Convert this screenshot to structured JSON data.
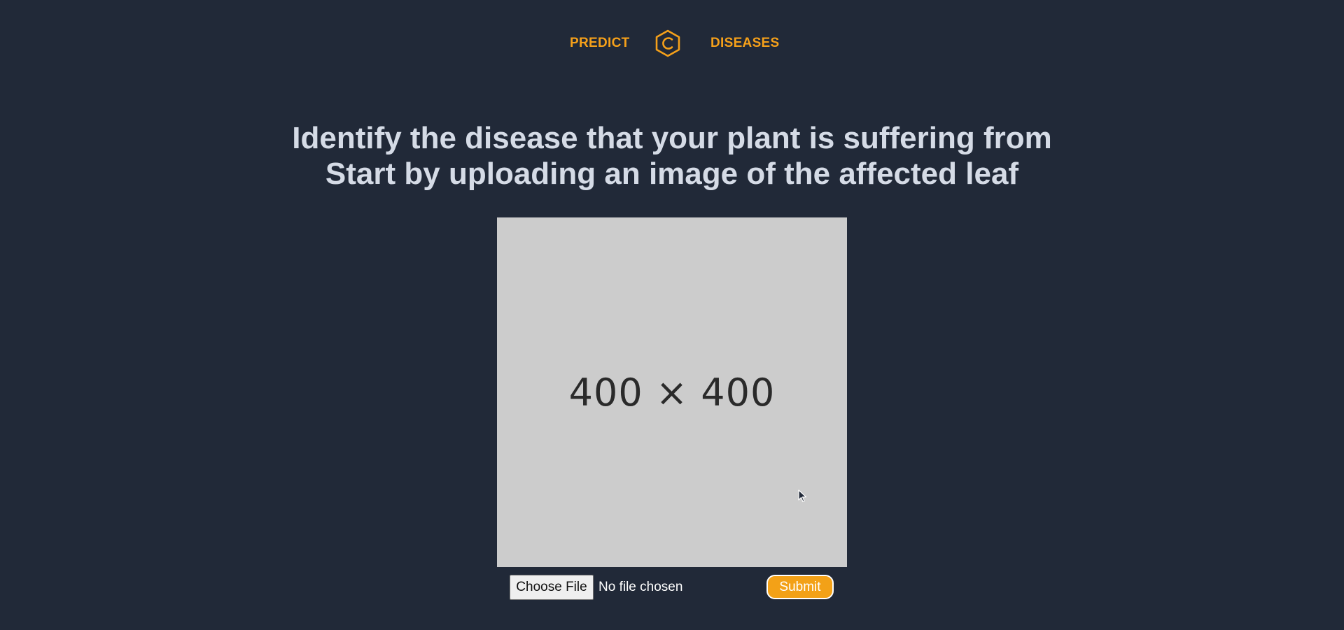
{
  "nav": {
    "predict_label": "PREDICT",
    "diseases_label": "DISEASES",
    "logo_icon": "hexagon-c-logo-icon",
    "accent_color": "#f5a01a"
  },
  "headline": {
    "line1": "Identify the disease that your plant is suffering from",
    "line2": "Start by uploading an image of the affected leaf"
  },
  "preview": {
    "placeholder_text": "400 × 400",
    "background_color": "#cccccc"
  },
  "upload": {
    "choose_file_label": "Choose File",
    "file_status": "No file chosen",
    "submit_label": "Submit",
    "submit_color": "#f3a117"
  },
  "theme": {
    "background": "#212938",
    "headline_color": "#d5dbe6"
  }
}
